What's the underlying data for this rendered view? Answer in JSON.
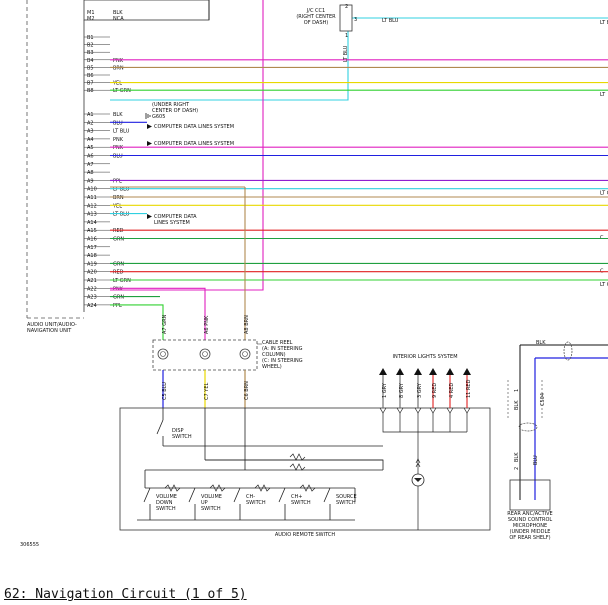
{
  "caption": "62: Navigation Circuit (1 of 5)",
  "figure_id": "306555",
  "audio_unit_label": [
    "AUDIO UNIT/AUDIO-",
    "NAVIGATION UNIT"
  ],
  "jc_label": [
    "J/C CC1",
    "(RIGHT CENTER",
    "OF DASH)"
  ],
  "jc_pins": {
    "left": "2",
    "right": "3",
    "bottom": "1"
  },
  "jc_wire": {
    "color": "LT BLU",
    "vertical": "LT BLU"
  },
  "under_right_center": [
    "(UNDER RIGHT",
    "CENTER OF DASH)",
    "G605"
  ],
  "computer_data_label": "COMPUTER DATA LINES SYSTEM",
  "computer_data_label2": [
    "COMPUTER DATA",
    "LINES SYSTEM"
  ],
  "cable_reel_label": [
    "CABLE REEL",
    "(A: IN STEERING",
    "COLUMN)",
    "(C: IN STEERING",
    "WHEEL)"
  ],
  "interior_lights_label": "INTERIOR LIGHTS SYSTEM",
  "audio_remote_label": "AUDIO REMOTE SWITCH",
  "disp_switch_label": [
    "DISP",
    "SWITCH"
  ],
  "switches": [
    {
      "lines": [
        "VOLUME",
        "DOWN",
        "SWITCH"
      ]
    },
    {
      "lines": [
        "VOLUME",
        "UP",
        "SWITCH"
      ]
    },
    {
      "lines": [
        "CH-",
        "SWITCH"
      ]
    },
    {
      "lines": [
        "CH+",
        "SWITCH"
      ]
    },
    {
      "lines": [
        "SOURCE",
        "SWITCH"
      ]
    }
  ],
  "mic_label": [
    "REAR ANC/ACTIVE",
    "SOUND CONTROL",
    "MICROPHONE",
    "(UNDER MIDDLE",
    "OF REAR SHELF)"
  ],
  "mic_wires": {
    "top": "BLK",
    "a": "BLK",
    "b": "C504",
    "pin1": "1",
    "pin2": "2",
    "blk2": "BLK",
    "blu": "BLU"
  },
  "top_pins": [
    {
      "pin": "M1",
      "label": "BLK"
    },
    {
      "pin": "M2",
      "label": "NCA"
    }
  ],
  "b_pins": [
    {
      "pin": "B1",
      "label": ""
    },
    {
      "pin": "B2",
      "label": ""
    },
    {
      "pin": "B3",
      "label": ""
    },
    {
      "pin": "B4",
      "label": "PNK"
    },
    {
      "pin": "B5",
      "label": "BRN"
    },
    {
      "pin": "B6",
      "label": ""
    },
    {
      "pin": "B7",
      "label": "YEL"
    },
    {
      "pin": "B8",
      "label": "LT GRN"
    }
  ],
  "a_pins": [
    {
      "pin": "A1",
      "label": "BLK"
    },
    {
      "pin": "A2",
      "label": "BLU"
    },
    {
      "pin": "A3",
      "label": "LT BLU"
    },
    {
      "pin": "A4",
      "label": "PNK"
    },
    {
      "pin": "A5",
      "label": "PNK"
    },
    {
      "pin": "A6",
      "label": "BLU"
    },
    {
      "pin": "A7",
      "label": ""
    },
    {
      "pin": "A8",
      "label": ""
    },
    {
      "pin": "A9",
      "label": "PPL"
    },
    {
      "pin": "A10",
      "label": "LT BLU"
    },
    {
      "pin": "A11",
      "label": "BRN"
    },
    {
      "pin": "A12",
      "label": "YEL"
    },
    {
      "pin": "A13",
      "label": "LT BLU"
    },
    {
      "pin": "A14",
      "label": ""
    },
    {
      "pin": "A15",
      "label": "RED"
    },
    {
      "pin": "A16",
      "label": "GRN"
    },
    {
      "pin": "A17",
      "label": ""
    },
    {
      "pin": "A18",
      "label": ""
    },
    {
      "pin": "A19",
      "label": "GRN"
    },
    {
      "pin": "A20",
      "label": "RED"
    },
    {
      "pin": "A21",
      "label": "LT GRN"
    },
    {
      "pin": "A22",
      "label": "PNK"
    },
    {
      "pin": "A23",
      "label": "GRN"
    },
    {
      "pin": "A24",
      "label": "PPL"
    }
  ],
  "right_edge_labels": [
    "LT BLU",
    "LT C",
    "LT",
    "C",
    "C",
    "LT C"
  ],
  "reel_top_labels": [
    "A7 GRN",
    "A6 PNK",
    "A8 BRN"
  ],
  "reel_bot_labels": [
    "C5 BLU",
    "C7 YEL",
    "C6 BRN"
  ],
  "light_pins": [
    "1 GRY",
    "8 GRY",
    "3 GRY",
    "9 RED",
    "4 RED",
    "11 RED"
  ],
  "colors": {
    "pnk": "#e020c0",
    "brn": "#b08a50",
    "yel": "#e8d800",
    "ltgrn": "#30d030",
    "blu": "#2020e0",
    "ltblu": "#30d0e0",
    "red": "#e02020",
    "grn": "#20a040",
    "ppl": "#9020d0",
    "blk": "#111111"
  }
}
